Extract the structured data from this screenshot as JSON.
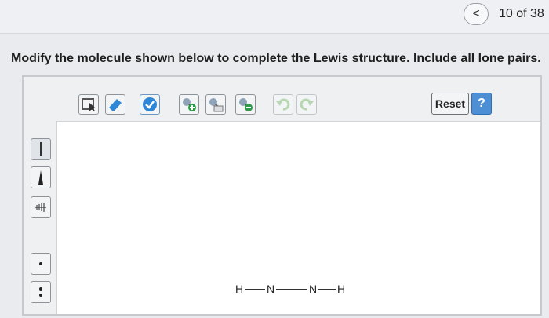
{
  "header": {
    "back_symbol": "<",
    "counter": "10 of 38"
  },
  "prompt": {
    "text": "Modify the molecule shown below to complete the Lewis structure. Include all lone pairs."
  },
  "toolbar": {
    "reset_label": "Reset",
    "help_label": "?",
    "tools": [
      "select-lasso-icon",
      "eraser-icon",
      "check-icon",
      "add-atom-icon",
      "atom-info-icon",
      "remove-atom-icon",
      "undo-icon",
      "redo-icon"
    ]
  },
  "sidebar": {
    "tools": [
      "single-bond-icon",
      "wedge-bond-icon",
      "hash-bond-icon",
      "lone-electron-icon",
      "lone-pair-icon"
    ]
  },
  "molecule": {
    "atoms": [
      "H",
      "N",
      "N",
      "H"
    ]
  },
  "colors": {
    "accent": "#2e86d6",
    "help": "#4c8fd4"
  }
}
